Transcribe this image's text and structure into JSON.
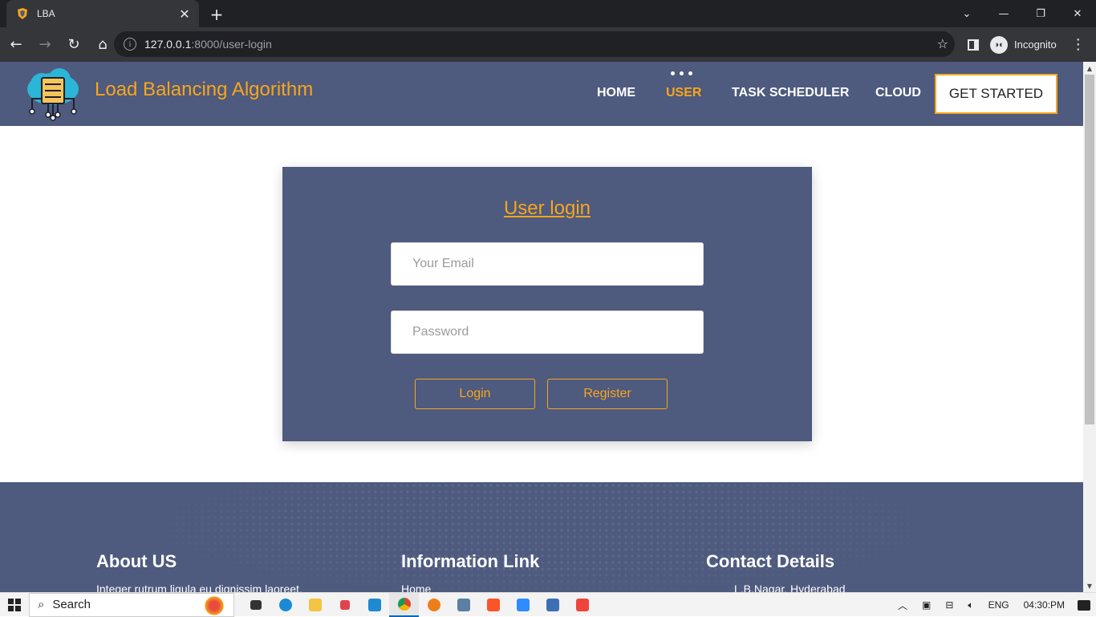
{
  "browser": {
    "tab_title": "LBA",
    "tab_close": "✕",
    "new_tab": "+",
    "url_host": "127.0.0.1",
    "url_path": ":8000/user-login",
    "incognito_label": "Incognito"
  },
  "header": {
    "brand": "Load Balancing Algorithm",
    "nav": [
      "HOME",
      "USER",
      "TASK SCHEDULER",
      "CLOUD"
    ],
    "active_nav": "USER",
    "cta": "GET STARTED",
    "accent_color": "#f7a61b",
    "bg_color": "#4e5a7e"
  },
  "login": {
    "title": "User login",
    "email_placeholder": "Your Email",
    "password_placeholder": "Password",
    "login_button": "Login",
    "register_button": "Register"
  },
  "footer": {
    "about_heading": "About US",
    "about_text": "Integer rutrum ligula eu dignissim laoreet.",
    "info_heading": "Information Link",
    "info_first": "Home",
    "contact_heading": "Contact Details",
    "contact_address": "L.B.Nagar, Hyderabad"
  },
  "taskbar": {
    "search_label": "Search",
    "language": "ENG",
    "time": "04:30:PM"
  },
  "icons": {
    "start": "windows-icon",
    "tray_up": "chevron-up-icon",
    "volume": "volume-icon",
    "network": "network-icon"
  }
}
